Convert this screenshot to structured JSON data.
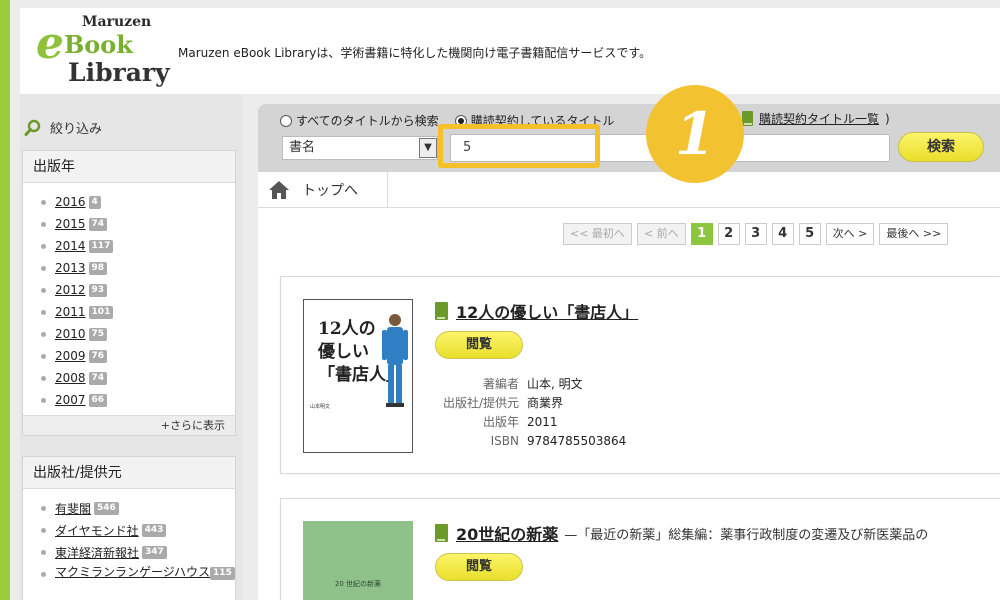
{
  "header": {
    "logo_line1": "Maruzen",
    "logo_e": "e",
    "logo_line2": "Book",
    "logo_line3": "Library",
    "tagline": "Maruzen eBook Libraryは、学術書籍に特化した機関向け電子書籍配信サービスです。"
  },
  "sidebar": {
    "filter_title": "絞り込み",
    "year_facet": {
      "title": "出版年",
      "items": [
        {
          "label": "2016",
          "count": "4"
        },
        {
          "label": "2015",
          "count": "74"
        },
        {
          "label": "2014",
          "count": "117"
        },
        {
          "label": "2013",
          "count": "98"
        },
        {
          "label": "2012",
          "count": "93"
        },
        {
          "label": "2011",
          "count": "101"
        },
        {
          "label": "2010",
          "count": "75"
        },
        {
          "label": "2009",
          "count": "76"
        },
        {
          "label": "2008",
          "count": "74"
        },
        {
          "label": "2007",
          "count": "66"
        }
      ],
      "more": "+さらに表示"
    },
    "publisher_facet": {
      "title": "出版社/提供元",
      "items": [
        {
          "label": "有斐閣",
          "count": "546"
        },
        {
          "label": "ダイヤモンド社",
          "count": "443"
        },
        {
          "label": "東洋経済新報社",
          "count": "347"
        },
        {
          "label": "マクミランランゲージハウス",
          "count": "115"
        }
      ]
    }
  },
  "search": {
    "radio_all": "すべてのタイトルから検索",
    "radio_subscribed": "購読契約しているタイトル",
    "subscribed_list_link": "購読契約タイトル一覧",
    "list_close": ")",
    "field_select": "書名",
    "query_value": "5",
    "search_button": "検索"
  },
  "annotation": {
    "step": "1"
  },
  "breadcrumb": {
    "home": "トップへ"
  },
  "pager": {
    "first": "<< 最初へ",
    "prev": "< 前へ",
    "pages": [
      "1",
      "2",
      "3",
      "4",
      "5"
    ],
    "current": "1",
    "next": "次へ >",
    "last": "最後へ >>"
  },
  "results": [
    {
      "title": "12人の優しい「書店人」",
      "subtitle": "",
      "cover_text_lines": [
        "12人の",
        "優しい",
        "「書店人」"
      ],
      "cover_author": "山本明文",
      "read_button": "閲覧",
      "meta": [
        {
          "key": "著編者",
          "value": "山本, 明文"
        },
        {
          "key": "出版社/提供元",
          "value": "商業界"
        },
        {
          "key": "出版年",
          "value": "2011"
        },
        {
          "key": "ISBN",
          "value": "9784785503864"
        }
      ]
    },
    {
      "title": "20世紀の新薬",
      "subtitle": "—「最近の新薬」総集編：薬事行政制度の変遷及び新医薬品の",
      "cover_text": "20 世紀の新薬",
      "read_button": "閲覧"
    }
  ],
  "colors": {
    "accent_green": "#8cc63f",
    "highlight_yellow": "#f5c12b",
    "button_yellow": "#f3ea45"
  }
}
